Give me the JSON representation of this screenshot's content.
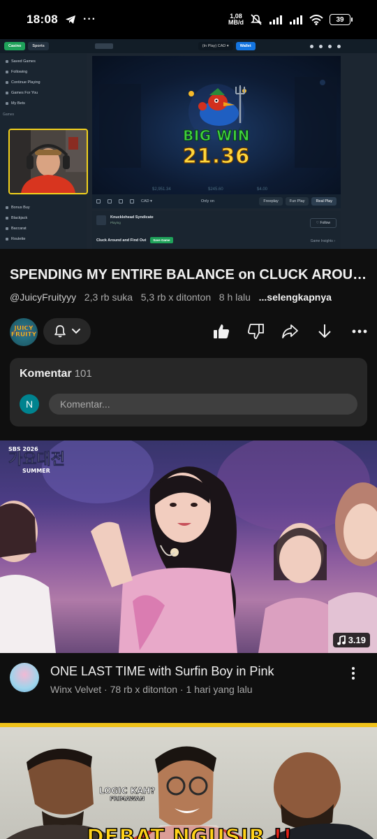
{
  "status_bar": {
    "time": "18:08",
    "net_speed_value": "1,08",
    "net_speed_unit": "MB/d",
    "battery": "39"
  },
  "player": {
    "site_tabs": [
      "Casino",
      "Sports"
    ],
    "balance_label": "(In Play)",
    "currency": "CAD",
    "wallet_label": "Wallet",
    "sidebar_items": [
      "Saved Games",
      "Following",
      "Continue Playing",
      "Games For You",
      "My Bets"
    ],
    "sidebar_heading": "Games",
    "sidebar_more_items": [
      "Bonus Buy",
      "Blackjack",
      "Baccarat",
      "Roulette"
    ],
    "win_label": "BIG WIN",
    "win_amount": "21.36",
    "game_stats": [
      "$2,951.34",
      "$245.60",
      "$4.00"
    ],
    "control_currency": "CAD",
    "control_center": "Only on",
    "control_buttons": [
      "Freeplay",
      "Fun Play",
      "Real Play"
    ],
    "game_name": "Knucklehead Syndicate",
    "game_sub": "Playing",
    "follow_label": "Follow",
    "game_line": "Cluck Around and Find Out",
    "save_game": "Save Game",
    "game_insights": "Game Insights"
  },
  "video": {
    "title": "SPENDING MY ENTIRE BALANCE on CLUCK AROUND AND FIND OUT",
    "channel_handle": "@JuicyFruityyy",
    "likes": "2,3 rb suka",
    "views": "5,3 rb x ditonton",
    "age": "8 h lalu",
    "more": "...selengkapnya",
    "channel_avatar_text": "JUICY FRUITY"
  },
  "actions": {
    "icons": [
      "thumbs-up-icon",
      "thumbs-down-icon",
      "share-icon",
      "download-icon",
      "more-icon"
    ]
  },
  "comments": {
    "title": "Komentar",
    "count": "101",
    "user_initial": "N",
    "placeholder": "Komentar..."
  },
  "next_video": {
    "logo_top": "SBS 2026",
    "logo_main": "가요대전",
    "logo_sub": "SUMMER",
    "duration": "3.19",
    "title": "ONE LAST TIME with Surfin Boy in Pink",
    "meta": "Winx Velvet · 78 rb x ditonton · 1 hari yang lalu"
  },
  "third_video": {
    "logic_line1": "LOGIC KAH?",
    "logic_line2": "FRIMAWAN",
    "headline": "DEBAT NGUSIR",
    "headline_bang": "!!"
  },
  "colors": {
    "background": "#0f0f0f",
    "surface": "#272727",
    "text_primary": "#f1f1f1",
    "text_secondary": "#aaaaaa",
    "webcam_border": "#f3d21c",
    "win_green": "#3fd23e",
    "win_gold": "#ffd63c"
  }
}
